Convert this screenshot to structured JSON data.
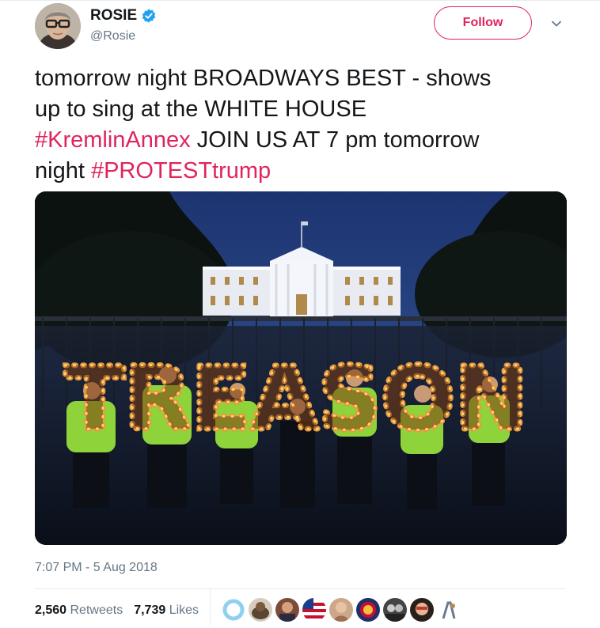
{
  "author": {
    "name": "ROSIE",
    "handle": "@Rosie",
    "verified": true
  },
  "follow_label": "Follow",
  "tweet": {
    "line1": "tomorrow night BROADWAYS BEST - shows",
    "line2": "up to sing at the WHITE HOUSE",
    "hashtag1": "#KremlinAnnex",
    "line3_rest": " JOIN US AT 7 pm tomorrow",
    "line4_start": "night ",
    "hashtag2": "#PROTESTtrump"
  },
  "photo_sign_text": "TREASON",
  "timestamp": "7:07 PM - 5 Aug 2018",
  "stats": {
    "retweets_count": "2,560",
    "retweets_label": "Retweets",
    "likes_count": "7,739",
    "likes_label": "Likes"
  },
  "colors": {
    "accent": "#e0245e",
    "verified": "#1da1f2",
    "secondary_text": "#657786",
    "bulb_letters": "#e89a3a"
  },
  "icons": [
    "verified-badge-icon",
    "chevron-down-icon"
  ]
}
